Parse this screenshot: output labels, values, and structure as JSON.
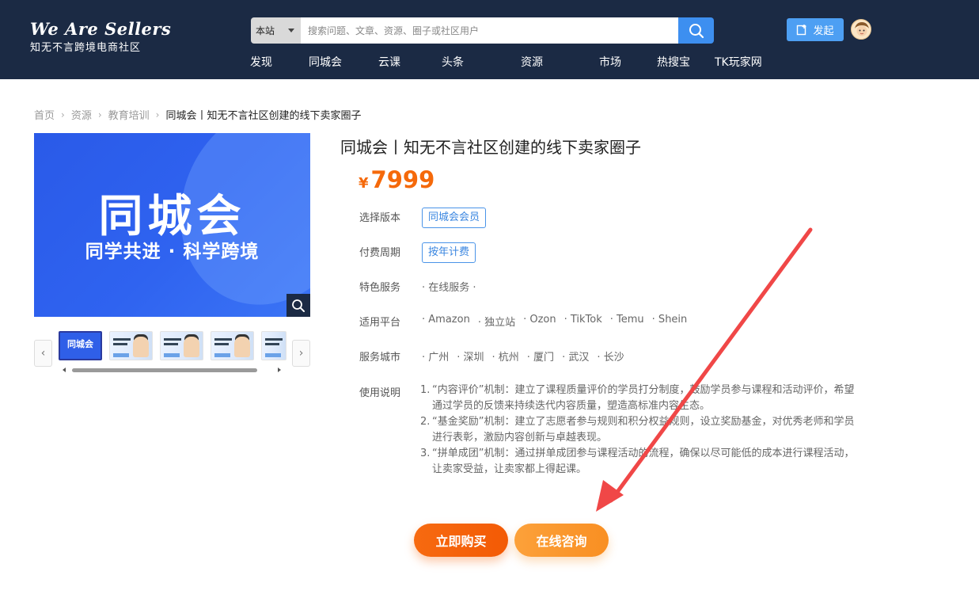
{
  "header": {
    "brand": "We Are Sellers",
    "tagline": "知无不言跨境电商社区",
    "search_scope": "本站",
    "search_placeholder": "搜索问题、文章、资源、圈子或社区用户",
    "nav": [
      "发现",
      "同城会",
      "云课",
      "头条",
      "资源",
      "市场",
      "热搜宝",
      "TK玩家网"
    ],
    "post_label": "发起"
  },
  "breadcrumb": {
    "items": [
      "首页",
      "资源",
      "教育培训"
    ],
    "current": "同城会丨知无不言社区创建的线下卖家圈子"
  },
  "product": {
    "image_title": "同城会",
    "image_subtitle": "同学共进 · 科学跨境",
    "thumb_first": "同城会",
    "title": "同城会丨知无不言社区创建的线下卖家圈子",
    "currency": "¥",
    "price": "7999",
    "version_label": "选择版本",
    "version_value": "同城会会员",
    "period_label": "付费周期",
    "period_value": "按年计费",
    "service_label": "特色服务",
    "service_value": "· 在线服务 ·",
    "platform_label": "适用平台",
    "platforms": [
      "· Amazon",
      "· 独立站",
      "· Ozon",
      "· TikTok",
      "· Temu",
      "· Shein"
    ],
    "city_label": "服务城市",
    "cities": [
      "· 广州",
      "· 深圳",
      "· 杭州",
      "· 厦门",
      "· 武汉",
      "· 长沙"
    ],
    "notes_label": "使用说明",
    "notes": [
      {
        "n": "1.",
        "t": "“内容评价”机制：建立了课程质量评价的学员打分制度，鼓励学员参与课程和活动评价，希望通过学员的反馈来持续迭代内容质量，塑造高标准内容生态。"
      },
      {
        "n": "2.",
        "t": "“基金奖励”机制：建立了志愿者参与规则和积分权益规则，设立奖励基金，对优秀老师和学员进行表彰，激励内容创新与卓越表现。"
      },
      {
        "n": "3.",
        "t": "“拼单成团”机制：通过拼单成团参与课程活动的流程，确保以尽可能低的成本进行课程活动，让卖家受益，让卖家都上得起课。"
      }
    ],
    "buy_label": "立即购买",
    "consult_label": "在线咨询"
  },
  "colors": {
    "header_bg": "#1b2a44",
    "accent_blue": "#3d8ff0",
    "price_orange": "#f5690a",
    "annotation_red": "#f04747"
  }
}
